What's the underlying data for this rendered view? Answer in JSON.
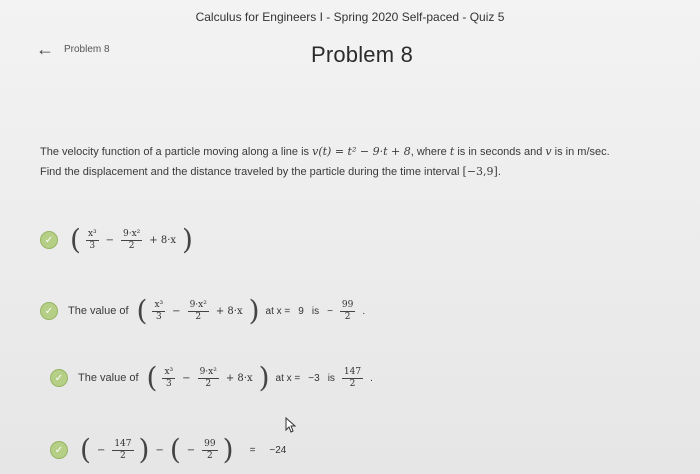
{
  "header": {
    "course_title": "Calculus for Engineers I - Spring 2020 Self-paced - Quiz 5",
    "back_label": "Problem 8",
    "problem_title": "Problem 8"
  },
  "question": {
    "line1_prefix": "The velocity function of a particle moving along a line is",
    "velocity_expr": "v(t) = t² − 9·t + 8",
    "line1_mid": ", where",
    "t_var": "t",
    "line1_mid2": "is in seconds and",
    "v_var": "v",
    "line1_suffix": "is in m/sec.",
    "line2_prefix": "Find the displacement and the distance traveled by the particle during the time interval",
    "interval": "[−3,9]",
    "line2_suffix": "."
  },
  "answers": {
    "row1": {
      "a": "x³",
      "b": "3",
      "c": "9·x²",
      "d": "2",
      "e": "+ 8·x"
    },
    "row2": {
      "label": "The value of",
      "at": "at x =",
      "xval": "9",
      "is": "is",
      "sign": "−",
      "num": "99",
      "den": "2",
      "end": "."
    },
    "row3": {
      "label": "The value of",
      "at": "at x =",
      "xval": "−3",
      "is": "is",
      "num": "147",
      "den": "2",
      "end": "."
    },
    "row4": {
      "n1": "147",
      "d1": "2",
      "n2": "99",
      "d2": "2",
      "eq": "=",
      "result": "−24"
    }
  },
  "colors": {
    "check_green": "#b5cf86",
    "background": "#e9e9e9"
  }
}
